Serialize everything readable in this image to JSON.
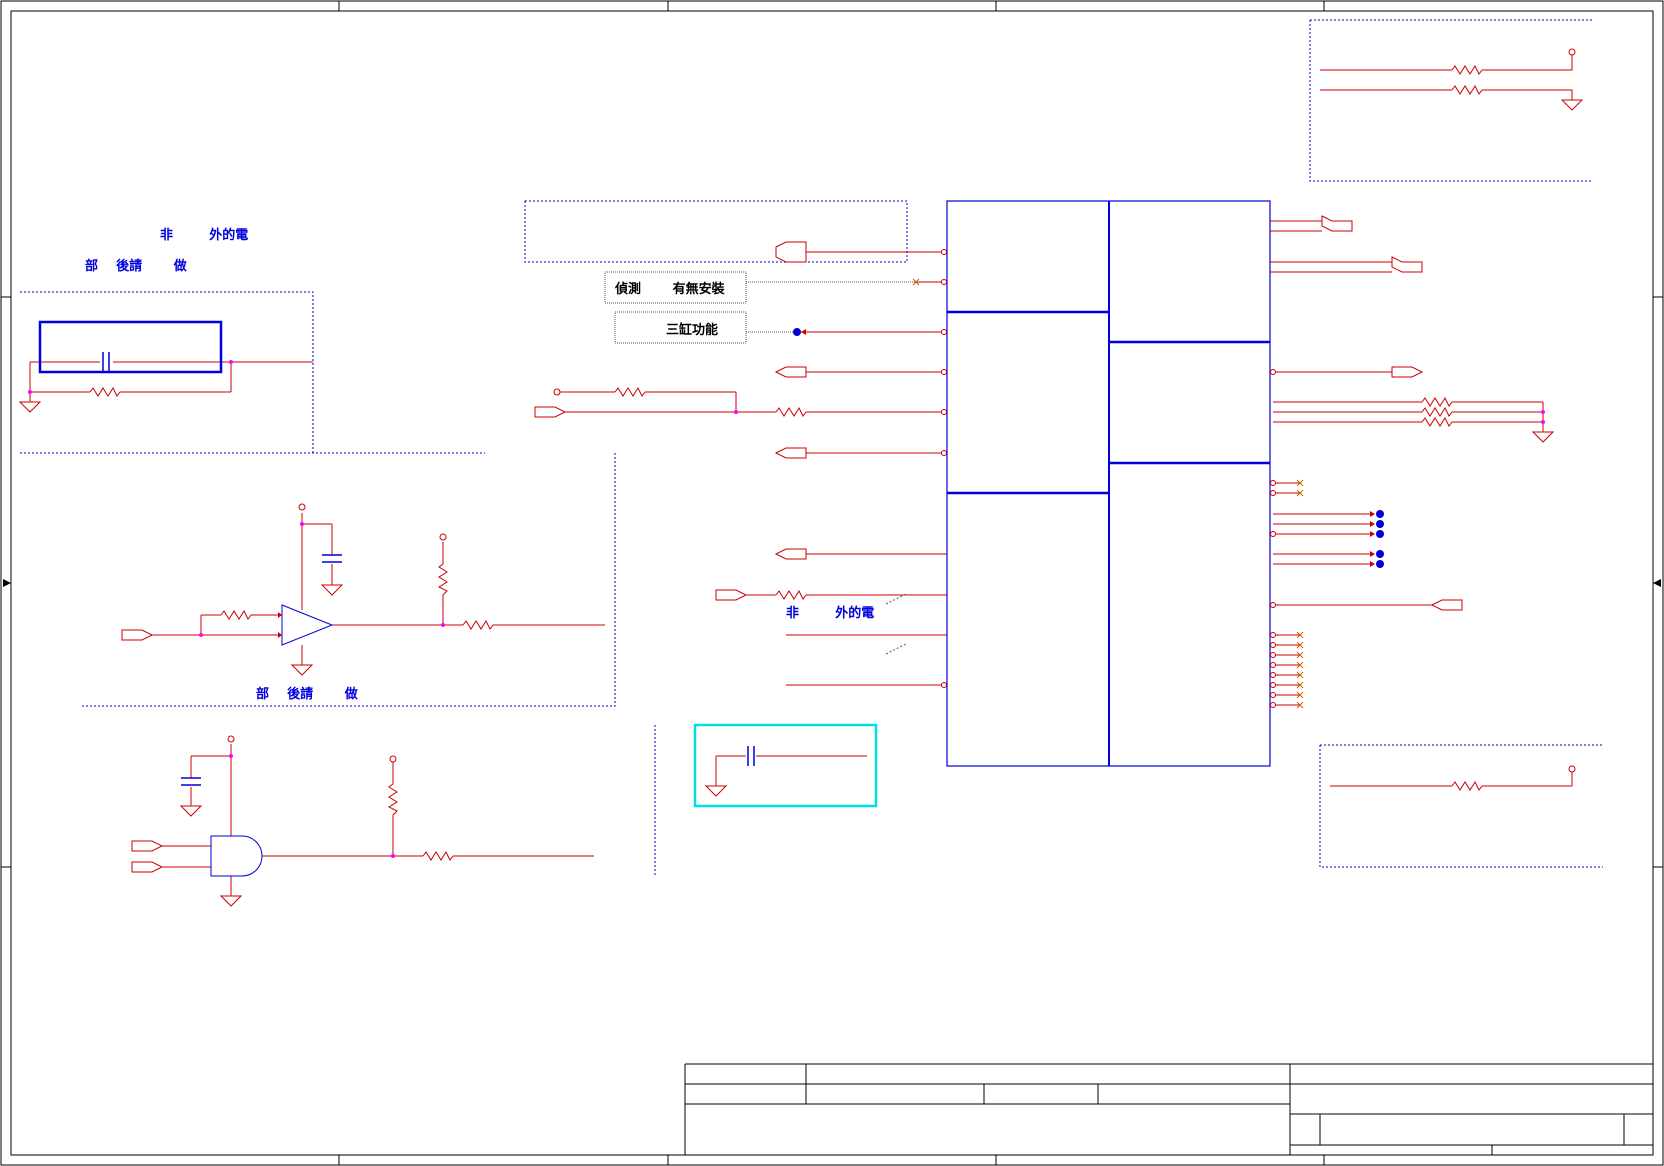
{
  "notes": {
    "left_top_line1": "非        外的電",
    "left_top_line2": "部    後請       做",
    "middle_line1": "非        外的電",
    "middle_line2": "部    後請       做"
  },
  "labels": {
    "detect": "偵測       有無安裝",
    "tri_color": "三缸功能"
  },
  "colors": {
    "frame": "#000000",
    "wire": "#cc0000",
    "ic": "#0000dd",
    "junction": "#ff00ff",
    "dashed": "#0000cc",
    "highlight": "#00e0e0"
  }
}
